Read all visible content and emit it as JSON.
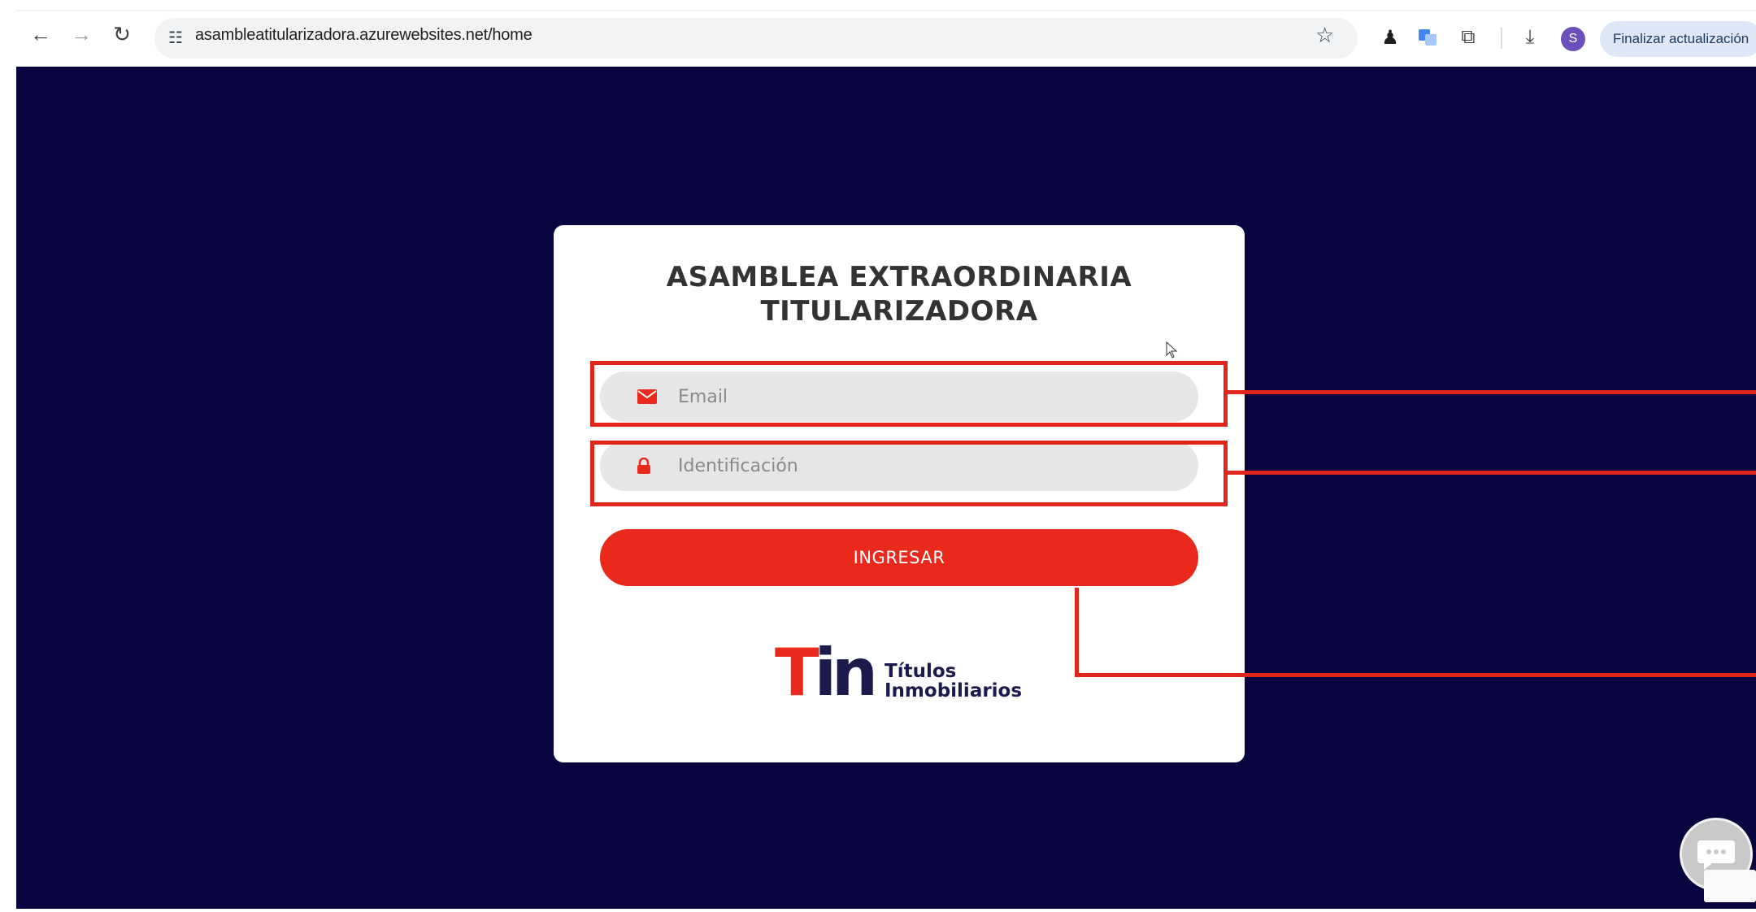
{
  "browser": {
    "url": "asambleatitularizadora.azurewebsites.net/home",
    "update_button_label": "Finalizar actualización",
    "profile_initial": "S",
    "icons": {
      "back": "back-arrow-icon",
      "forward": "forward-arrow-icon",
      "reload": "reload-icon",
      "site_info": "tune-icon",
      "bookmark": "star-icon",
      "download": "download-icon"
    }
  },
  "login": {
    "title_line1": "ASAMBLEA EXTRAORDINARIA",
    "title_line2": "TITULARIZADORA",
    "email_placeholder": "Email",
    "id_placeholder": "Identificación",
    "submit_label": "INGRESAR",
    "brand_line1": "Títulos",
    "brand_line2": "Inmobiliarios"
  },
  "colors": {
    "page_background": "#070440",
    "accent": "#e8291c",
    "annotation": "#e0261b",
    "brand_navy": "#1d1a4e"
  }
}
